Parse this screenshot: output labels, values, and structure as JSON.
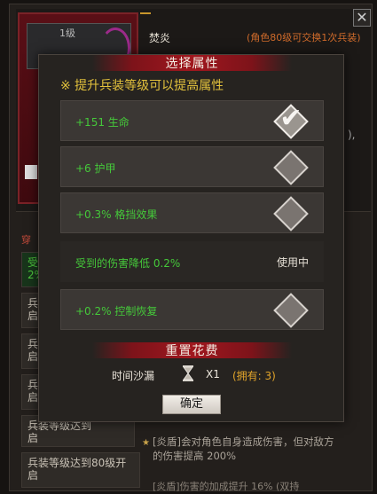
{
  "background": {
    "level": "1级",
    "name": "焚炎",
    "exchange_note": "(角色80级可交换1次兵装)",
    "dot_text": "),",
    "close_glyph": "✕",
    "left_tab": "穿",
    "left_items": [
      "受\n2%",
      "兵\n启",
      "兵\n启",
      "兵\n启",
      "兵\n启",
      "兵装等级达到\n启",
      "兵装等级达到80级开\n启"
    ],
    "bottom_text": "[炎盾]会对角色自身造成伤害，但对敌方的伤害提高 200%",
    "bottom_text2": "[炎盾]伤害的加成提升 16% (双持"
  },
  "modal": {
    "title": "选择属性",
    "hint": "※ 提升兵装等级可以提高属性",
    "options": [
      {
        "label": "+151 生命",
        "state": "checked"
      },
      {
        "label": "+6 护甲",
        "state": "unchecked"
      },
      {
        "label": "+0.3% 格挡效果",
        "state": "unchecked"
      },
      {
        "label": "受到的伤害降低 0.2%",
        "state": "in_use",
        "status_text": "使用中"
      },
      {
        "label": "+0.2% 控制恢复",
        "state": "unchecked"
      }
    ],
    "reset_title": "重置花费",
    "cost": {
      "item_name": "时间沙漏",
      "icon": "hourglass-icon",
      "quantity": "X1",
      "owned": "(拥有: 3)"
    },
    "confirm_label": "确定"
  },
  "colors": {
    "green_text": "#45c83a",
    "gold_text": "#e2c13c",
    "banner_red": "#a0171e",
    "orange_text": "#e2a52a"
  }
}
